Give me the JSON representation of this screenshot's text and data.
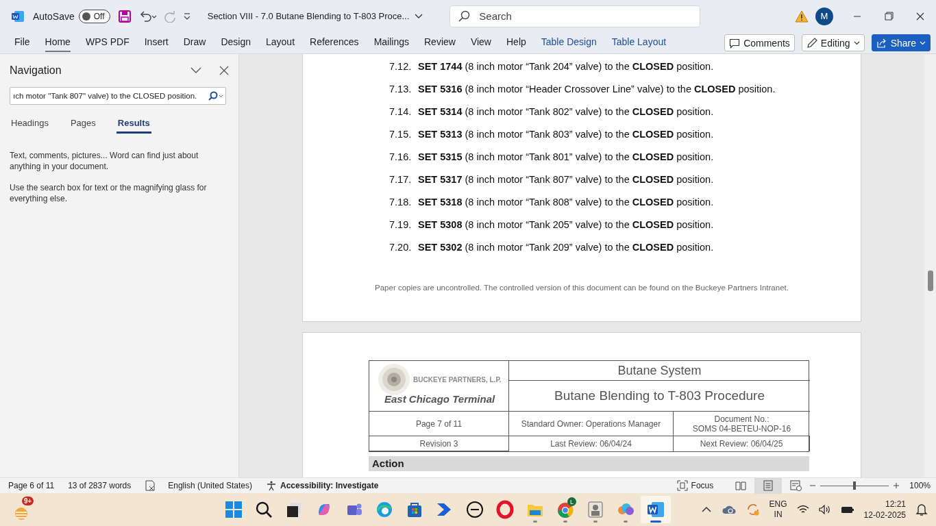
{
  "title_bar": {
    "autosave_label": "AutoSave",
    "autosave": {
      "label": "Off",
      "on": false
    },
    "document_title": "Section VIII - 7.0 Butane Blending to T-803 Proce...",
    "search": {
      "placeholder": "Search"
    },
    "avatar": "M"
  },
  "ribbon_tabs": [
    {
      "label": "File",
      "selected": false,
      "kind": "normal"
    },
    {
      "label": "Home",
      "selected": true,
      "kind": "normal"
    },
    {
      "label": "WPS PDF",
      "selected": false,
      "kind": "normal"
    },
    {
      "label": "Insert",
      "selected": false,
      "kind": "normal"
    },
    {
      "label": "Draw",
      "selected": false,
      "kind": "normal"
    },
    {
      "label": "Design",
      "selected": false,
      "kind": "normal"
    },
    {
      "label": "Layout",
      "selected": false,
      "kind": "normal"
    },
    {
      "label": "References",
      "selected": false,
      "kind": "normal"
    },
    {
      "label": "Mailings",
      "selected": false,
      "kind": "normal"
    },
    {
      "label": "Review",
      "selected": false,
      "kind": "normal"
    },
    {
      "label": "View",
      "selected": false,
      "kind": "normal"
    },
    {
      "label": "Help",
      "selected": false,
      "kind": "normal"
    },
    {
      "label": "Table Design",
      "selected": false,
      "kind": "contextual"
    },
    {
      "label": "Table Layout",
      "selected": false,
      "kind": "contextual"
    }
  ],
  "ribbon_buttons": {
    "comments": "Comments",
    "editing": "Editing",
    "share": "Share"
  },
  "navigation": {
    "title": "Navigation",
    "search_value": "ıch motor \"Tank 807\" valve) to the CLOSED position.",
    "tabs": [
      {
        "label": "Headings",
        "selected": false
      },
      {
        "label": "Pages",
        "selected": false
      },
      {
        "label": "Results",
        "selected": true
      }
    ],
    "messages": [
      "Text, comments, pictures... Word can find just about anything in your document.",
      "Use the search box for text or the magnifying glass for everything else."
    ]
  },
  "document": {
    "steps": [
      {
        "number": "7.12.",
        "text": "**SET 1744** (8 inch motor “Tank 204” valve) to the **CLOSED** position."
      },
      {
        "number": "7.13.",
        "text": "**SET 5316** (8 inch motor “Header Crossover Line” valve) to the **CLOSED** position."
      },
      {
        "number": "7.14.",
        "text": "**SET 5314** (8 inch motor “Tank 802” valve) to the **CLOSED** position."
      },
      {
        "number": "7.15.",
        "text": "**SET 5313** (8 inch motor “Tank 803” valve) to the **CLOSED** position."
      },
      {
        "number": "7.16.",
        "text": "**SET 5315** (8 inch motor “Tank 801” valve) to the **CLOSED** position."
      },
      {
        "number": "7.17.",
        "text": "**SET 5317** (8 inch motor “Tank 807” valve) to the **CLOSED** position."
      },
      {
        "number": "7.18.",
        "text": "**SET 5318** (8 inch motor “Tank 808” valve) to the **CLOSED** position."
      },
      {
        "number": "7.19.",
        "text": "**SET 5308** (8 inch motor “Tank 205” valve) to the **CLOSED** position."
      },
      {
        "number": "7.20.",
        "text": "**SET 5302** (8 inch motor “Tank 209” valve) to the **CLOSED** position."
      }
    ],
    "footer": "Paper copies are uncontrolled. The controlled version of this document can be found on the Buckeye Partners Intranet.",
    "header_table": {
      "company": "BUCKEYE PARTNERS, L.P.",
      "terminal": "East Chicago Terminal",
      "system": "Butane System",
      "procedure": "Butane Blending to T-803 Procedure",
      "page": "Page 7 of 11",
      "owner": "Standard Owner: Operations Manager",
      "document_no_label": "Document No.:",
      "document_no": "SOMS 04-BETEU-NOP-16",
      "revision": "Revision 3",
      "last_review": "Last Review: 06/04/24",
      "next_review": "Next Review: 06/04/25"
    },
    "section_heading": "Action"
  },
  "status_bar": {
    "page": "Page 6 of 11",
    "words": "13 of 2837 words",
    "language": "English (United States)",
    "accessibility": "Accessibility: Investigate",
    "focus": "Focus",
    "zoom": {
      "level": 0.5
    },
    "zoom_percent": "100%"
  },
  "taskbar": {
    "widget_badge": "9+",
    "apps": [
      {
        "kind": "start",
        "running": false,
        "active": false
      },
      {
        "kind": "search",
        "running": false,
        "active": false
      },
      {
        "kind": "taskview",
        "running": false,
        "active": false
      },
      {
        "kind": "copilot",
        "running": false,
        "active": false
      },
      {
        "kind": "teams",
        "running": false,
        "active": false
      },
      {
        "kind": "edge",
        "running": false,
        "active": false
      },
      {
        "kind": "store",
        "running": false,
        "active": false
      },
      {
        "kind": "automate",
        "running": false,
        "active": false
      },
      {
        "kind": "dell",
        "running": false,
        "active": false
      },
      {
        "kind": "opera",
        "running": false,
        "active": false
      },
      {
        "kind": "explorer",
        "running": true,
        "active": false
      },
      {
        "kind": "chrome",
        "running": true,
        "active": false,
        "badge": "L"
      },
      {
        "kind": "portrait",
        "running": true,
        "active": false
      },
      {
        "kind": "cloud",
        "running": true,
        "active": false
      },
      {
        "kind": "word",
        "running": true,
        "active": true
      }
    ],
    "language": "ENG",
    "region": "IN",
    "time": "12:21",
    "date": "12-02-2025"
  }
}
